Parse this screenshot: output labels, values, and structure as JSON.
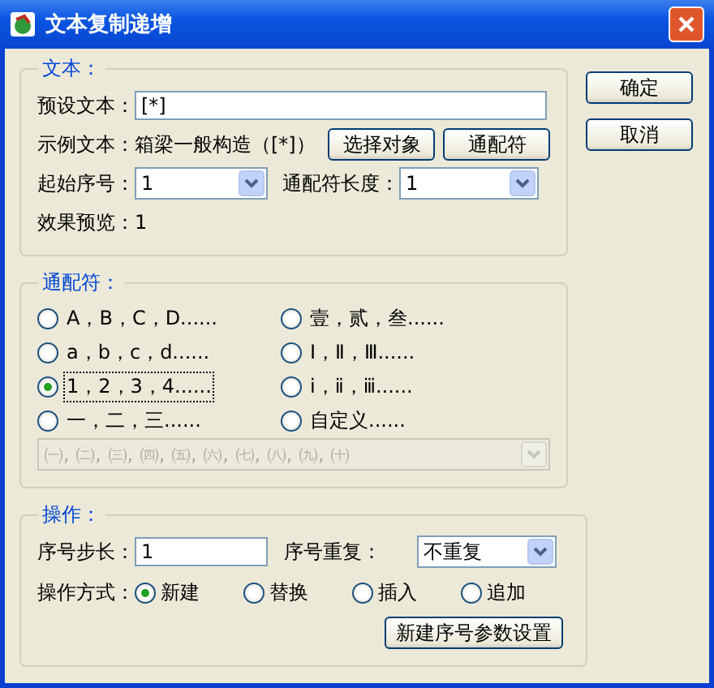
{
  "window": {
    "title": "文本复制递增"
  },
  "text_group": {
    "title": "文本：",
    "preset_label": "预设文本：",
    "preset_value": "[*]",
    "example_label": "示例文本：",
    "example_value": "箱梁一般构造（[*]）",
    "buttons": [
      "选择对象",
      "通配符"
    ],
    "start_label": "起始序号：",
    "start_value": "1",
    "length_label": "通配符长度：",
    "length_value": "1",
    "preview_label": "效果预览：",
    "preview_value": "1"
  },
  "wildcard_group": {
    "title": "通配符：",
    "options": [
      {
        "label": "A，B，C，D......",
        "selected": false
      },
      {
        "label": "壹，贰，叁......",
        "selected": false
      },
      {
        "label": "a，b，c，d......",
        "selected": false
      },
      {
        "label": "Ⅰ，Ⅱ，Ⅲ......",
        "selected": false
      },
      {
        "label": "1，2，3，4......",
        "selected": true
      },
      {
        "label": "ⅰ，ⅱ，ⅲ......",
        "selected": false
      },
      {
        "label": "一，二，三......",
        "selected": false
      },
      {
        "label": "自定义......",
        "selected": false
      }
    ],
    "custom_combo": {
      "value": "㈠, ㈡, ㈢, ㈣, ㈤, ㈥, ㈦, ㈧, ㈨, ㈩",
      "disabled": true
    }
  },
  "operation_group": {
    "title": "操作：",
    "step_label": "序号步长：",
    "step_value": "1",
    "repeat_label": "序号重复：",
    "repeat_value": "不重复",
    "mode_label": "操作方式：",
    "modes": [
      {
        "label": "新建",
        "selected": true
      },
      {
        "label": "替换",
        "selected": false
      },
      {
        "label": "插入",
        "selected": false
      },
      {
        "label": "追加",
        "selected": false
      }
    ],
    "settings_button": "新建序号参数设置"
  },
  "buttons": [
    "确定",
    "取消"
  ]
}
